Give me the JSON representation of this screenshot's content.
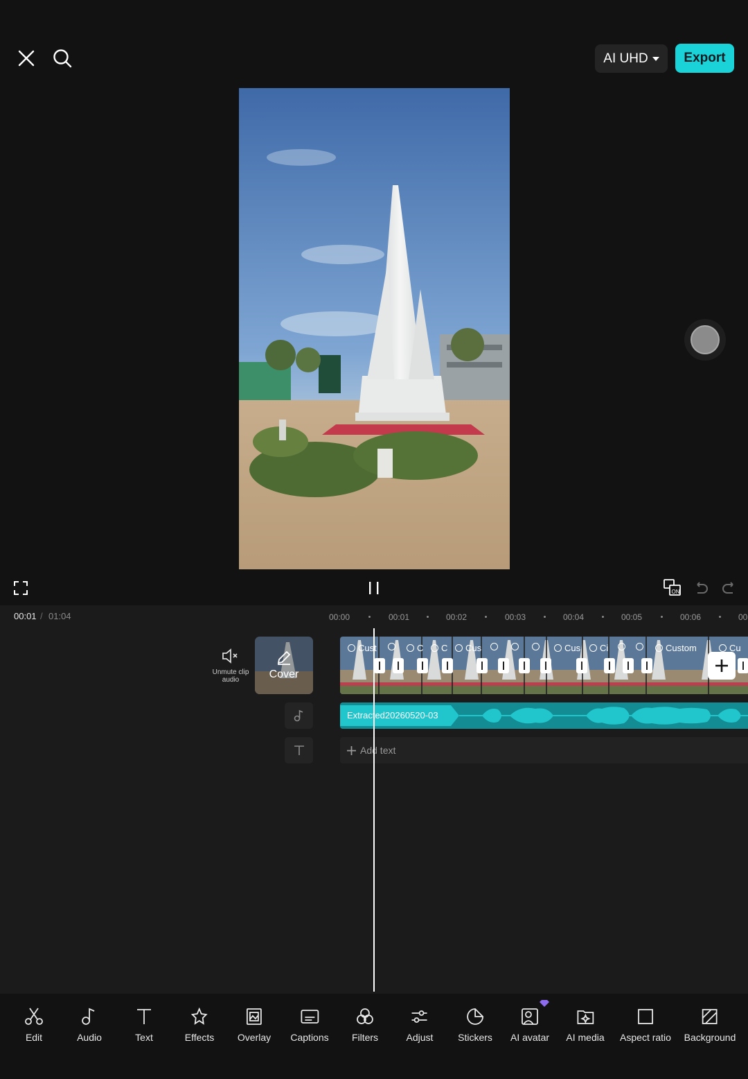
{
  "header": {
    "quality_label": "AI UHD",
    "export_label": "Export"
  },
  "time": {
    "current": "00:01",
    "separator": "/",
    "total": "01:04"
  },
  "ruler": [
    "00:00",
    "00:01",
    "00:02",
    "00:03",
    "00:04",
    "00:05",
    "00:06",
    "00"
  ],
  "tracks": {
    "unmute_label": "Unmute clip audio",
    "cover_label": "Cover",
    "effect_labels": [
      "Cust",
      "C",
      "C",
      "Cus",
      "Cus",
      "Ci",
      "Custom",
      "Cu"
    ],
    "audio_label": "Extracted20260520-03",
    "add_text_label": "Add text"
  },
  "toolbar": {
    "items": [
      {
        "label": "Edit",
        "icon": "scissors-icon"
      },
      {
        "label": "Audio",
        "icon": "music-note-icon"
      },
      {
        "label": "Text",
        "icon": "text-icon"
      },
      {
        "label": "Effects",
        "icon": "star-icon"
      },
      {
        "label": "Overlay",
        "icon": "overlay-icon"
      },
      {
        "label": "Captions",
        "icon": "captions-icon"
      },
      {
        "label": "Filters",
        "icon": "filters-icon"
      },
      {
        "label": "Adjust",
        "icon": "sliders-icon"
      },
      {
        "label": "Stickers",
        "icon": "sticker-icon"
      },
      {
        "label": "AI avatar",
        "icon": "ai-avatar-icon"
      },
      {
        "label": "AI media",
        "icon": "ai-media-icon"
      },
      {
        "label": "Aspect ratio",
        "icon": "aspect-ratio-icon"
      },
      {
        "label": "Background",
        "icon": "background-icon"
      }
    ]
  },
  "colors": {
    "accent": "#19d3d8",
    "audio_track": "#138c93",
    "background": "#121212"
  }
}
